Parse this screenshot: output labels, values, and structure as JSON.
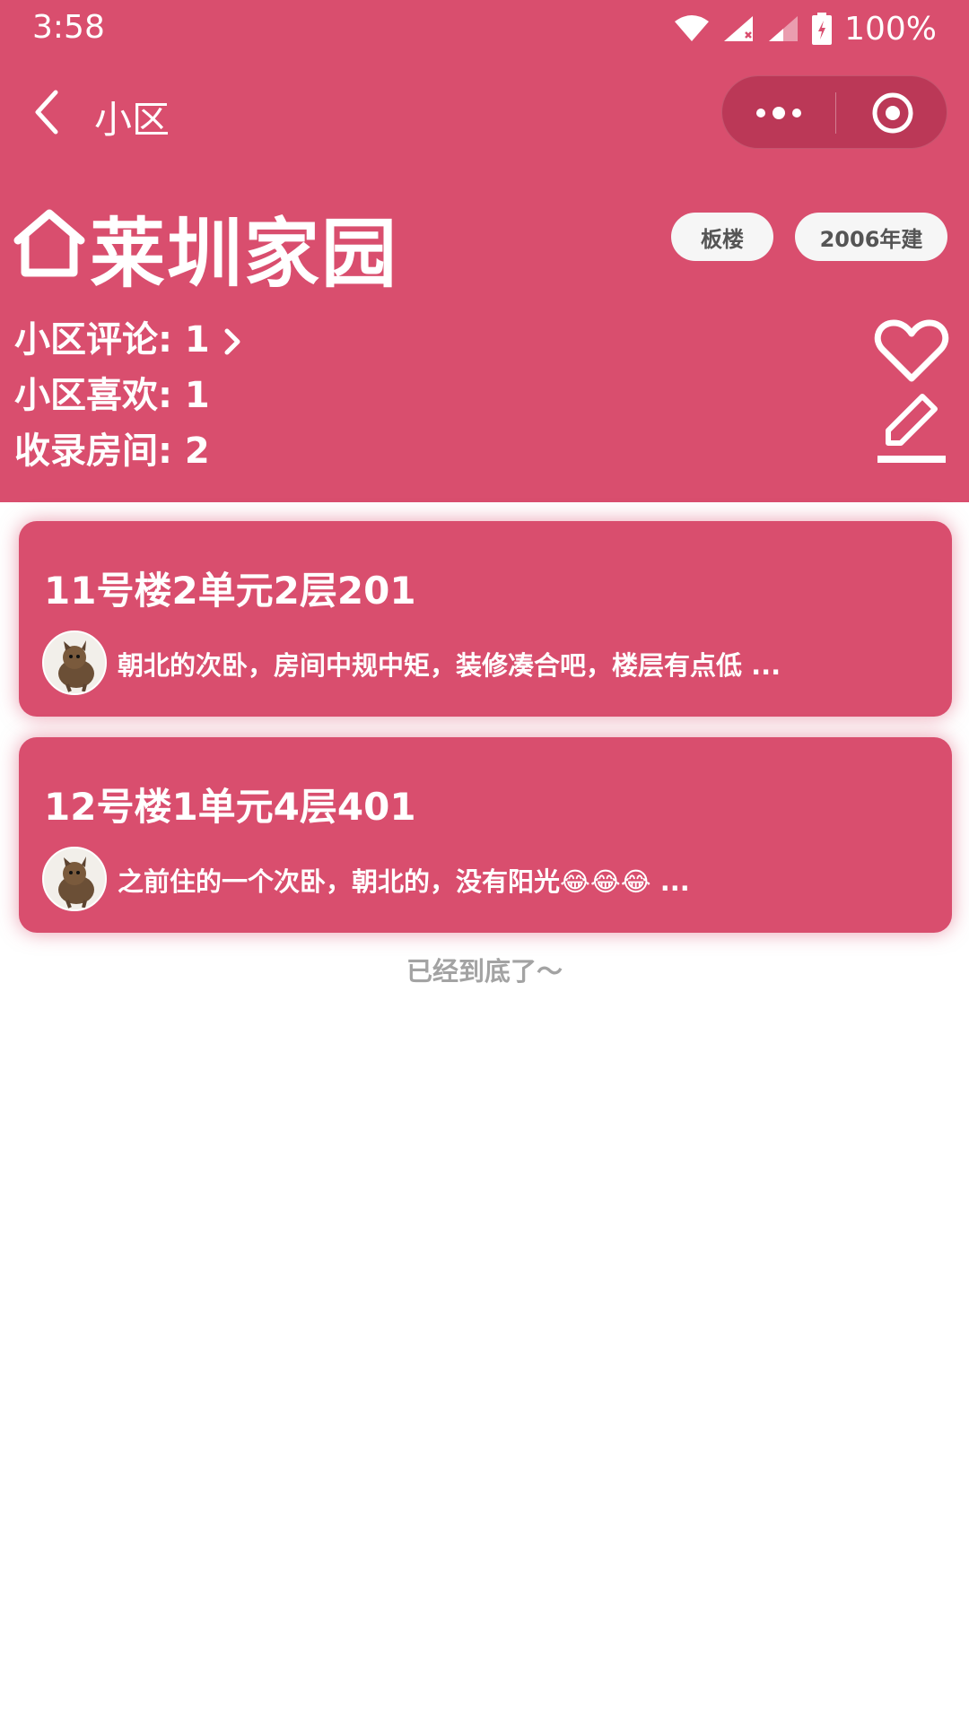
{
  "status_bar": {
    "time": "3:58",
    "battery": "100%"
  },
  "nav": {
    "title": "小区"
  },
  "community": {
    "name": "莱圳家园",
    "tags": [
      "板楼",
      "2006年建"
    ],
    "comments": "小区评论: 1",
    "likes": "小区喜欢: 1",
    "rooms": "收录房间: 2"
  },
  "rooms": [
    {
      "title": "11号楼2单元2层201",
      "excerpt": "朝北的次卧，房间中规中矩，装修凑合吧，楼层有点低 ..."
    },
    {
      "title": "12号楼1单元4层401",
      "excerpt": "之前住的一个次卧，朝北的，没有阳光😂😂😂 ..."
    }
  ],
  "footer": {
    "end_text": "已经到底了～"
  },
  "colors": {
    "primary": "#d94e6e",
    "tag_bg": "#f6f6f6",
    "muted": "#a3a3a3"
  },
  "icons": [
    "back-icon",
    "more-icon",
    "close-target-icon",
    "home-icon",
    "chevron-right-icon",
    "heart-icon",
    "edit-icon",
    "wifi-icon",
    "signal-icon",
    "battery-icon"
  ]
}
